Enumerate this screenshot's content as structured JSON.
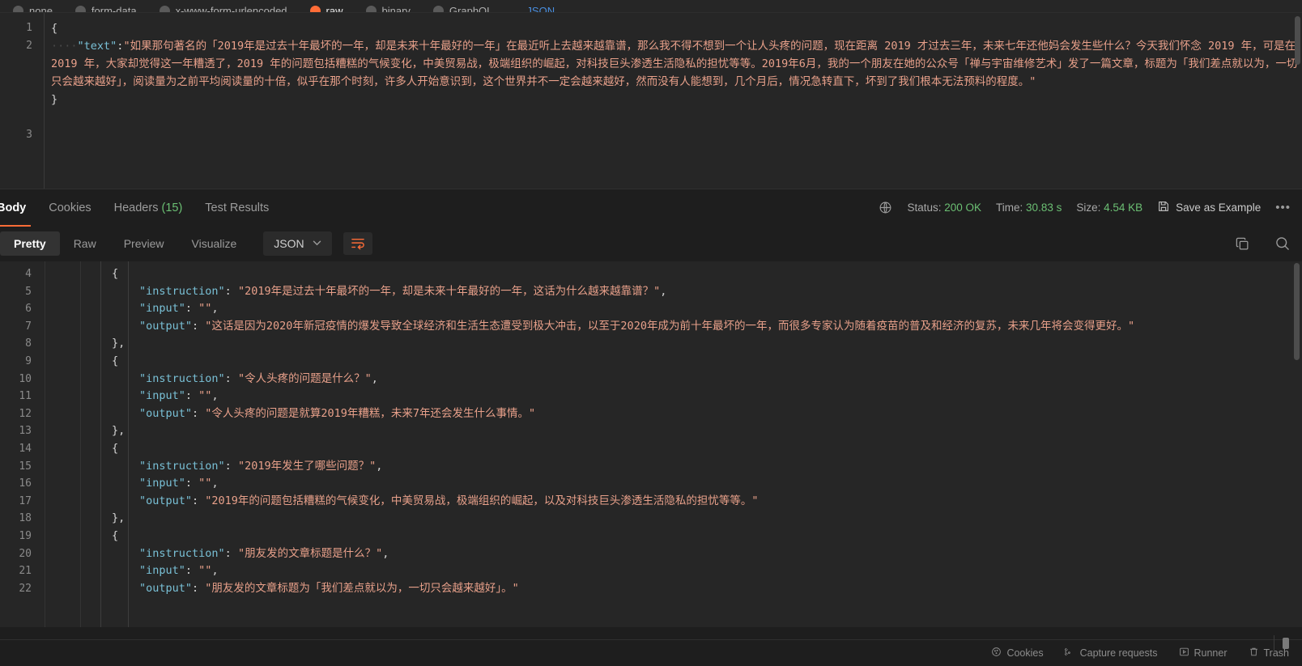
{
  "body_type_row": {
    "options": [
      {
        "label": "none",
        "selected": false
      },
      {
        "label": "form-data",
        "selected": false
      },
      {
        "label": "x-www-form-urlencoded",
        "selected": false
      },
      {
        "label": "raw",
        "selected": true
      },
      {
        "label": "binary",
        "selected": false
      },
      {
        "label": "GraphQL",
        "selected": false
      }
    ],
    "language_label": "JSON"
  },
  "request_editor": {
    "line_numbers": [
      "1",
      "2",
      "3"
    ],
    "open_brace": "{",
    "key": "\"text\"",
    "colon": ":",
    "indent_dots": "····",
    "value": "\"如果那句著名的「2019年是过去十年最坏的一年，却是未来十年最好的一年」在最近听上去越来越靠谱，那么我不得不想到一个让人头疼的问题，现在距离 2019 才过去三年，未来七年还他妈会发生些什么？今天我们怀念 2019 年，可是在 2019 年，大家却觉得这一年糟透了，2019 年的问题包括糟糕的气候变化，中美贸易战，极端组织的崛起，对科技巨头渗透生活隐私的担忧等等。2019年6月，我的一个朋友在她的公众号「禅与宇宙维修艺术」发了一篇文章，标题为「我们差点就以为，一切只会越来越好」，阅读量为之前平均阅读量的十倍，似乎在那个时刻，许多人开始意识到，这个世界并不一定会越来越好，然而没有人能想到，几个月后，情况急转直下，坏到了我们根本无法预料的程度。\"",
    "close_brace": "}"
  },
  "response_tabs": {
    "items": [
      {
        "label": "Body",
        "active": true,
        "count": ""
      },
      {
        "label": "Cookies",
        "active": false,
        "count": ""
      },
      {
        "label": "Headers",
        "active": false,
        "count": "(15)"
      },
      {
        "label": "Test Results",
        "active": false,
        "count": ""
      }
    ]
  },
  "response_meta": {
    "status_label": "Status:",
    "status_value": "200 OK",
    "time_label": "Time:",
    "time_value": "30.83 s",
    "size_label": "Size:",
    "size_value": "4.54 KB",
    "save_as_example": "Save as Example",
    "more_dots": "•••"
  },
  "format_bar": {
    "views": [
      {
        "label": "Pretty",
        "active": true
      },
      {
        "label": "Raw",
        "active": false
      },
      {
        "label": "Preview",
        "active": false
      },
      {
        "label": "Visualize",
        "active": false
      }
    ],
    "language": "JSON",
    "chevron": "⌄"
  },
  "response_body": {
    "line_numbers": [
      "4",
      "5",
      "6",
      "7",
      "8",
      "9",
      "10",
      "11",
      "12",
      "13",
      "14",
      "15",
      "16",
      "17",
      "18",
      "19",
      "20",
      "21",
      "22"
    ],
    "lines": [
      {
        "n": "4",
        "indent": "i1",
        "kind": "punc",
        "text": "{"
      },
      {
        "n": "5",
        "indent": "i2",
        "kind": "kv",
        "key": "\"instruction\"",
        "sep": ": ",
        "val": "\"2019年是过去十年最坏的一年，却是未来十年最好的一年，这话为什么越来越靠谱？\"",
        "tail": ","
      },
      {
        "n": "6",
        "indent": "i2",
        "kind": "kv",
        "key": "\"input\"",
        "sep": ": ",
        "val": "\"\"",
        "tail": ","
      },
      {
        "n": "7",
        "indent": "i2",
        "kind": "kv",
        "key": "\"output\"",
        "sep": ": ",
        "val": "\"这话是因为2020年新冠疫情的爆发导致全球经济和生活生态遭受到极大冲击，以至于2020年成为前十年最坏的一年，而很多专家认为随着疫苗的普及和经济的复苏，未来几年将会变得更好。\"",
        "tail": ""
      },
      {
        "n": "8",
        "indent": "i1",
        "kind": "punc",
        "text": "},"
      },
      {
        "n": "9",
        "indent": "i1",
        "kind": "punc",
        "text": "{"
      },
      {
        "n": "10",
        "indent": "i2",
        "kind": "kv",
        "key": "\"instruction\"",
        "sep": ": ",
        "val": "\"令人头疼的问题是什么？\"",
        "tail": ","
      },
      {
        "n": "11",
        "indent": "i2",
        "kind": "kv",
        "key": "\"input\"",
        "sep": ": ",
        "val": "\"\"",
        "tail": ","
      },
      {
        "n": "12",
        "indent": "i2",
        "kind": "kv",
        "key": "\"output\"",
        "sep": ": ",
        "val": "\"令人头疼的问题是就算2019年糟糕，未来7年还会发生什么事情。\"",
        "tail": ""
      },
      {
        "n": "13",
        "indent": "i1",
        "kind": "punc",
        "text": "},"
      },
      {
        "n": "14",
        "indent": "i1",
        "kind": "punc",
        "text": "{"
      },
      {
        "n": "15",
        "indent": "i2",
        "kind": "kv",
        "key": "\"instruction\"",
        "sep": ": ",
        "val": "\"2019年发生了哪些问题？\"",
        "tail": ","
      },
      {
        "n": "16",
        "indent": "i2",
        "kind": "kv",
        "key": "\"input\"",
        "sep": ": ",
        "val": "\"\"",
        "tail": ","
      },
      {
        "n": "17",
        "indent": "i2",
        "kind": "kv",
        "key": "\"output\"",
        "sep": ": ",
        "val": "\"2019年的问题包括糟糕的气候变化，中美贸易战，极端组织的崛起，以及对科技巨头渗透生活隐私的担忧等等。\"",
        "tail": ""
      },
      {
        "n": "18",
        "indent": "i1",
        "kind": "punc",
        "text": "},"
      },
      {
        "n": "19",
        "indent": "i1",
        "kind": "punc",
        "text": "{"
      },
      {
        "n": "20",
        "indent": "i2",
        "kind": "kv",
        "key": "\"instruction\"",
        "sep": ": ",
        "val": "\"朋友发的文章标题是什么？\"",
        "tail": ","
      },
      {
        "n": "21",
        "indent": "i2",
        "kind": "kv",
        "key": "\"input\"",
        "sep": ": ",
        "val": "\"\"",
        "tail": ","
      },
      {
        "n": "22",
        "indent": "i2",
        "kind": "kv",
        "key": "\"output\"",
        "sep": ": ",
        "val": "\"朋友发的文章标题为「我们差点就以为，一切只会越来越好」。\"",
        "tail": ""
      }
    ]
  },
  "bottom_bar": {
    "items": [
      {
        "label": "Cookies",
        "icon": "cookie-icon"
      },
      {
        "label": "Capture requests",
        "icon": "satellite-icon"
      },
      {
        "label": "Runner",
        "icon": "runner-icon"
      },
      {
        "label": "Trash",
        "icon": "trash-icon"
      }
    ]
  },
  "colors": {
    "accent": "#ff6c37",
    "success": "#6bbf73",
    "key": "#79c0d6",
    "string": "#e8a08a",
    "bg": "#262626",
    "panel_bg": "#1e1e1e"
  }
}
